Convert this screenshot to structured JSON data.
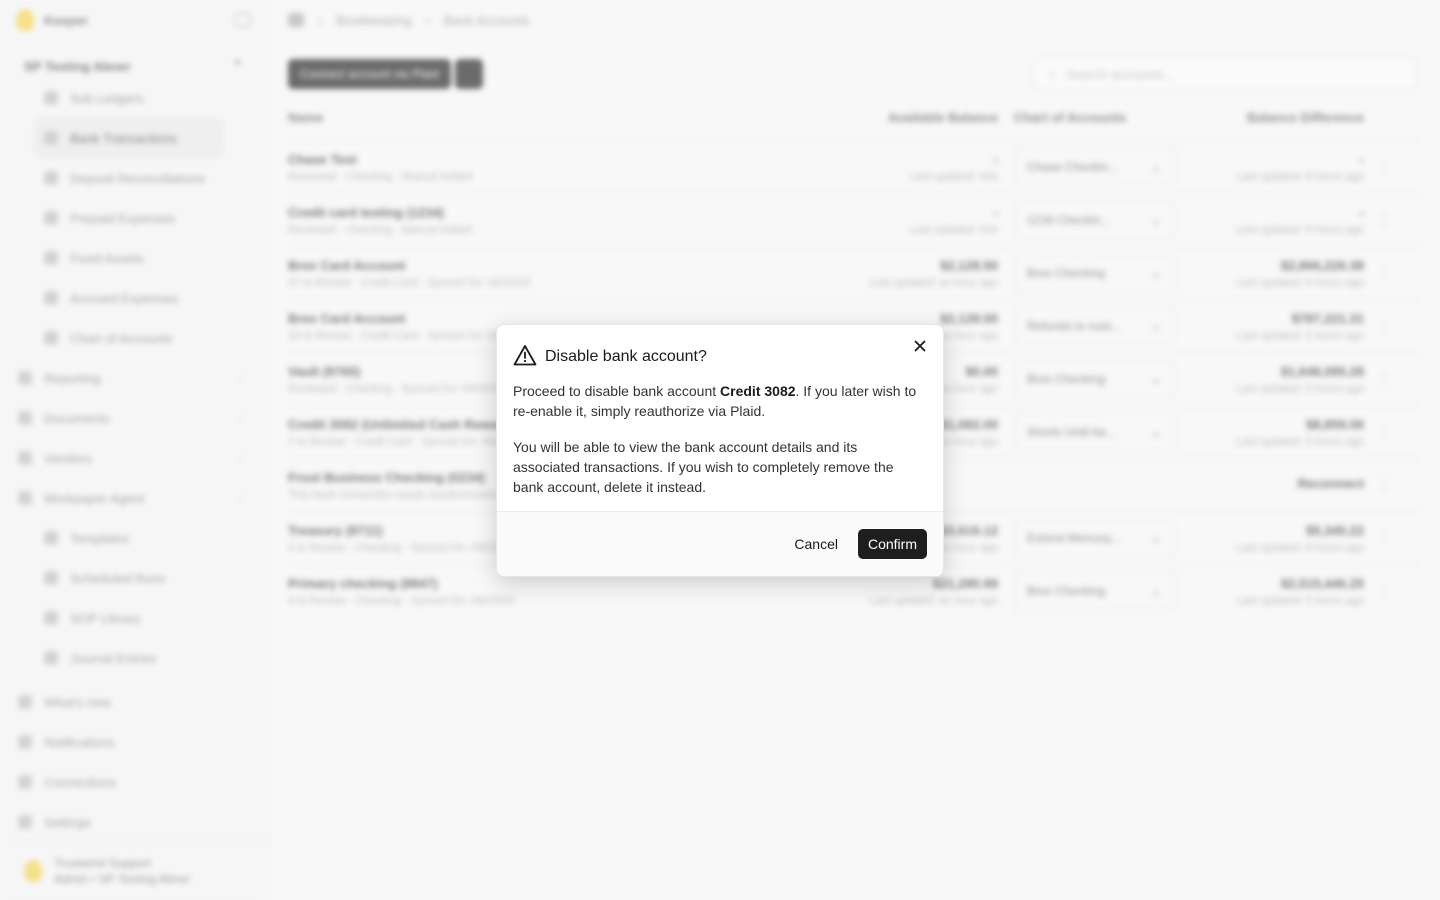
{
  "app": {
    "brand": "Keeper",
    "org": "SP Testing Abner",
    "nav_sub_items": [
      "Sub Ledgers",
      "Bank Transactions",
      "Deposit Reconciliations",
      "Prepaid Expenses",
      "Fixed Assets",
      "Accrued Expenses",
      "Chart of Accounts"
    ],
    "nav_top_items": [
      "Reporting",
      "Documents",
      "Vendors",
      "Workpaper Agent"
    ],
    "nav_sub2_items": [
      "Templates",
      "Scheduled Runs",
      "SOP Library",
      "Journal Entries"
    ],
    "nav_bottom_items": [
      "What's new",
      "Notifications",
      "Connections",
      "Settings"
    ],
    "footer_name": "Trustwind Support",
    "footer_role": "Admin • SP Testing Abner"
  },
  "breadcrumb": [
    "Bookkeeping",
    "Bank Accounts"
  ],
  "toolbar": {
    "connect_label": "Connect account via Plaid",
    "search_placeholder": "Search accounts..."
  },
  "table": {
    "headers": [
      "Name",
      "Available Balance",
      "Chart of Accounts",
      "Balance Difference"
    ],
    "rows": [
      {
        "name": "Chase Test",
        "sub": "Reviewed · Checking · Manual Added",
        "bal": "-",
        "bal_sub": "Last updated: N/A",
        "coa": "Chase Checkin...",
        "diff": "-",
        "diff_sub": "Last updated: 8 hours ago"
      },
      {
        "name": "Credit card testing (1234)",
        "sub": "Reviewed · Checking · Manual Added",
        "bal": "-",
        "bal_sub": "Last updated: N/A",
        "coa": "1234 Checkin...",
        "diff": "-",
        "diff_sub": "Last updated: 8 hours ago"
      },
      {
        "name": "Brex Card Account",
        "sub": "47 to Review · Credit Card · Synced On: 09/25/25",
        "bal": "$2,128.50",
        "bal_sub": "Last updated: an hour ago",
        "coa": "Brex Checking",
        "diff": "$2,866,226.38",
        "diff_sub": "Last updated: 5 hours ago"
      },
      {
        "name": "Brex Card Account",
        "sub": "33 to Review · Credit Card · Synced On: 09/25/25",
        "bal": "$2,128.50",
        "bal_sub": "Last updated: an hour ago",
        "coa": "Refunds to cust...",
        "diff": "$787,221.31",
        "diff_sub": "Last updated: 5 hours ago"
      },
      {
        "name": "Vault (8765)",
        "sub": "Reviewed · Checking · Synced On: 09/25/25",
        "bal": "$0.00",
        "bal_sub": "Last updated: an hour ago",
        "coa": "Brex Checking",
        "diff": "$1,648,085.28",
        "diff_sub": "Last updated: 5 hours ago"
      },
      {
        "name": "Credit 3082 (Unlimited Cash Rewards)",
        "sub": "7 to Review · Credit Card · Synced On: 09/25/25",
        "bal": "$1,082.00",
        "bal_sub": "Last updated: an hour ago",
        "coa": "Shorts Until ba...",
        "diff": "$8,859.06",
        "diff_sub": "Last updated: 5 hours ago"
      },
      {
        "name": "Frost Business Checking (0234)",
        "sub": "This bank connection needs reauthorization",
        "bal": "",
        "bal_sub": "",
        "coa": "",
        "diff": "Reconnect",
        "diff_sub": ""
      },
      {
        "name": "Treasury (8711)",
        "sub": "2 to Review · Checking · Synced On: 09/25/25",
        "bal": "$3,616.12",
        "bal_sub": "Last updated: an hour ago",
        "coa": "Extend Mercury...",
        "diff": "$5,345.22",
        "diff_sub": "Last updated: 8 hours ago"
      },
      {
        "name": "Primary checking (8847)",
        "sub": "4 to Review · Checking · Synced On: 09/25/25",
        "bal": "$21,280.99",
        "bal_sub": "Last updated: an hour ago",
        "coa": "Brex Checking",
        "diff": "$2,515,446.25",
        "diff_sub": "Last updated: 5 hours ago"
      }
    ]
  },
  "modal": {
    "title": "Disable bank account?",
    "p1_before": "Proceed to disable bank account ",
    "p1_account": "Credit 3082",
    "p1_after": ". If you later wish to re-enable it, simply reauthorize via Plaid.",
    "p2": "You will be able to view the bank account details and its associated transactions. If you wish to completely remove the bank account, delete it instead.",
    "cancel_label": "Cancel",
    "confirm_label": "Confirm"
  }
}
